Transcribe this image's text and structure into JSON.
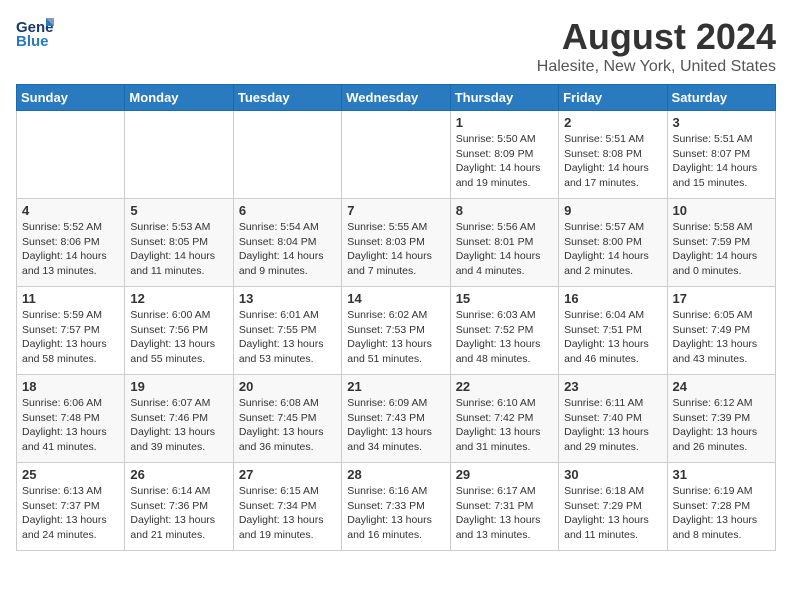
{
  "header": {
    "logo_line1": "General",
    "logo_line2": "Blue",
    "title": "August 2024",
    "subtitle": "Halesite, New York, United States"
  },
  "weekdays": [
    "Sunday",
    "Monday",
    "Tuesday",
    "Wednesday",
    "Thursday",
    "Friday",
    "Saturday"
  ],
  "weeks": [
    [
      {
        "day": "",
        "info": ""
      },
      {
        "day": "",
        "info": ""
      },
      {
        "day": "",
        "info": ""
      },
      {
        "day": "",
        "info": ""
      },
      {
        "day": "1",
        "info": "Sunrise: 5:50 AM\nSunset: 8:09 PM\nDaylight: 14 hours\nand 19 minutes."
      },
      {
        "day": "2",
        "info": "Sunrise: 5:51 AM\nSunset: 8:08 PM\nDaylight: 14 hours\nand 17 minutes."
      },
      {
        "day": "3",
        "info": "Sunrise: 5:51 AM\nSunset: 8:07 PM\nDaylight: 14 hours\nand 15 minutes."
      }
    ],
    [
      {
        "day": "4",
        "info": "Sunrise: 5:52 AM\nSunset: 8:06 PM\nDaylight: 14 hours\nand 13 minutes."
      },
      {
        "day": "5",
        "info": "Sunrise: 5:53 AM\nSunset: 8:05 PM\nDaylight: 14 hours\nand 11 minutes."
      },
      {
        "day": "6",
        "info": "Sunrise: 5:54 AM\nSunset: 8:04 PM\nDaylight: 14 hours\nand 9 minutes."
      },
      {
        "day": "7",
        "info": "Sunrise: 5:55 AM\nSunset: 8:03 PM\nDaylight: 14 hours\nand 7 minutes."
      },
      {
        "day": "8",
        "info": "Sunrise: 5:56 AM\nSunset: 8:01 PM\nDaylight: 14 hours\nand 4 minutes."
      },
      {
        "day": "9",
        "info": "Sunrise: 5:57 AM\nSunset: 8:00 PM\nDaylight: 14 hours\nand 2 minutes."
      },
      {
        "day": "10",
        "info": "Sunrise: 5:58 AM\nSunset: 7:59 PM\nDaylight: 14 hours\nand 0 minutes."
      }
    ],
    [
      {
        "day": "11",
        "info": "Sunrise: 5:59 AM\nSunset: 7:57 PM\nDaylight: 13 hours\nand 58 minutes."
      },
      {
        "day": "12",
        "info": "Sunrise: 6:00 AM\nSunset: 7:56 PM\nDaylight: 13 hours\nand 55 minutes."
      },
      {
        "day": "13",
        "info": "Sunrise: 6:01 AM\nSunset: 7:55 PM\nDaylight: 13 hours\nand 53 minutes."
      },
      {
        "day": "14",
        "info": "Sunrise: 6:02 AM\nSunset: 7:53 PM\nDaylight: 13 hours\nand 51 minutes."
      },
      {
        "day": "15",
        "info": "Sunrise: 6:03 AM\nSunset: 7:52 PM\nDaylight: 13 hours\nand 48 minutes."
      },
      {
        "day": "16",
        "info": "Sunrise: 6:04 AM\nSunset: 7:51 PM\nDaylight: 13 hours\nand 46 minutes."
      },
      {
        "day": "17",
        "info": "Sunrise: 6:05 AM\nSunset: 7:49 PM\nDaylight: 13 hours\nand 43 minutes."
      }
    ],
    [
      {
        "day": "18",
        "info": "Sunrise: 6:06 AM\nSunset: 7:48 PM\nDaylight: 13 hours\nand 41 minutes."
      },
      {
        "day": "19",
        "info": "Sunrise: 6:07 AM\nSunset: 7:46 PM\nDaylight: 13 hours\nand 39 minutes."
      },
      {
        "day": "20",
        "info": "Sunrise: 6:08 AM\nSunset: 7:45 PM\nDaylight: 13 hours\nand 36 minutes."
      },
      {
        "day": "21",
        "info": "Sunrise: 6:09 AM\nSunset: 7:43 PM\nDaylight: 13 hours\nand 34 minutes."
      },
      {
        "day": "22",
        "info": "Sunrise: 6:10 AM\nSunset: 7:42 PM\nDaylight: 13 hours\nand 31 minutes."
      },
      {
        "day": "23",
        "info": "Sunrise: 6:11 AM\nSunset: 7:40 PM\nDaylight: 13 hours\nand 29 minutes."
      },
      {
        "day": "24",
        "info": "Sunrise: 6:12 AM\nSunset: 7:39 PM\nDaylight: 13 hours\nand 26 minutes."
      }
    ],
    [
      {
        "day": "25",
        "info": "Sunrise: 6:13 AM\nSunset: 7:37 PM\nDaylight: 13 hours\nand 24 minutes."
      },
      {
        "day": "26",
        "info": "Sunrise: 6:14 AM\nSunset: 7:36 PM\nDaylight: 13 hours\nand 21 minutes."
      },
      {
        "day": "27",
        "info": "Sunrise: 6:15 AM\nSunset: 7:34 PM\nDaylight: 13 hours\nand 19 minutes."
      },
      {
        "day": "28",
        "info": "Sunrise: 6:16 AM\nSunset: 7:33 PM\nDaylight: 13 hours\nand 16 minutes."
      },
      {
        "day": "29",
        "info": "Sunrise: 6:17 AM\nSunset: 7:31 PM\nDaylight: 13 hours\nand 13 minutes."
      },
      {
        "day": "30",
        "info": "Sunrise: 6:18 AM\nSunset: 7:29 PM\nDaylight: 13 hours\nand 11 minutes."
      },
      {
        "day": "31",
        "info": "Sunrise: 6:19 AM\nSunset: 7:28 PM\nDaylight: 13 hours\nand 8 minutes."
      }
    ]
  ]
}
